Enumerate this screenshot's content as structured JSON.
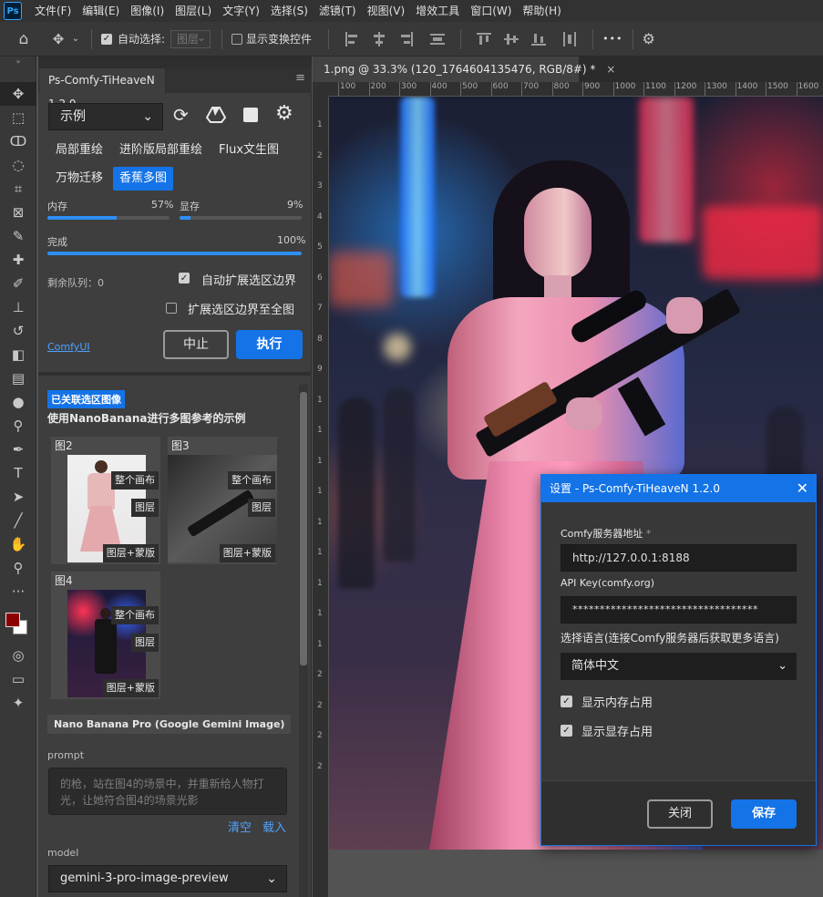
{
  "app": {
    "logo": "Ps"
  },
  "menu": [
    "文件(F)",
    "编辑(E)",
    "图像(I)",
    "图层(L)",
    "文字(Y)",
    "选择(S)",
    "滤镜(T)",
    "视图(V)",
    "增效工具",
    "窗口(W)",
    "帮助(H)"
  ],
  "options": {
    "auto_select_label": "自动选择:",
    "auto_select_checked": true,
    "layer_select_value": "图层",
    "show_transform_label": "显示变换控件",
    "more_glyph": "•••"
  },
  "panel": {
    "tab_title": "Ps-Comfy-TiHeaveN 1.2.0",
    "preset_select": "示例",
    "tags": [
      "局部重绘",
      "进阶版局部重绘",
      "Flux文生图",
      "万物迁移",
      "香蕉多图"
    ],
    "selected_tag": "香蕉多图",
    "memory": {
      "label": "内存",
      "value": "57%",
      "fraction": 0.57
    },
    "vram": {
      "label": "显存",
      "value": "9%",
      "fraction": 0.09
    },
    "progress": {
      "label": "完成",
      "value": "100%",
      "fraction": 1.0
    },
    "queue_label": "剩余队列：0",
    "auto_expand_label": "自动扩展选区边界",
    "auto_expand_checked": true,
    "expand_full_label": "扩展选区边界至全图",
    "expand_full_checked": false,
    "comfy_link": "ComfyUI",
    "stop_button": "中止",
    "run_button": "执行",
    "linked_badge": "已关联选区图像",
    "workflow_title": "使用NanoBanana进行多图参考的示例",
    "images": [
      {
        "title": "图2",
        "buttons": [
          "整个画布",
          "图层",
          "图层+蒙版"
        ]
      },
      {
        "title": "图3",
        "buttons": [
          "整个画布",
          "图层",
          "图层+蒙版"
        ]
      },
      {
        "title": "图4",
        "buttons": [
          "整个画布",
          "图层",
          "图层+蒙版"
        ]
      }
    ],
    "node_label": "Nano Banana Pro (Google Gemini Image)",
    "prompt_label": "prompt",
    "prompt_text": "的枪，站在图4的场景中，并重新给人物打光，让她符合图4的场景光影",
    "clear_link": "清空",
    "load_link": "载入",
    "model_label": "model",
    "model_value": "gemini-3-pro-image-preview"
  },
  "document": {
    "tab_title": "1.png @ 33.3% (120_1764604135476, RGB/8#) *",
    "close_glyph": "×",
    "ruler_top": [
      "100",
      "200",
      "300",
      "400",
      "500",
      "600",
      "700",
      "800",
      "900",
      "1000",
      "1100",
      "1200",
      "1300",
      "1400",
      "1500",
      "1600"
    ],
    "ruler_left": [
      "1",
      "2",
      "3",
      "4",
      "5",
      "6",
      "7",
      "8",
      "9",
      "1",
      "1",
      "1",
      "1",
      "1",
      "1",
      "1",
      "1",
      "1",
      "2",
      "2",
      "2",
      "2"
    ]
  },
  "dialog": {
    "title": "设置 - Ps-Comfy-TiHeaveN 1.2.0",
    "server_label": "Comfy服务器地址",
    "required_mark": "*",
    "server_value": "http://127.0.0.1:8188",
    "api_label": "API Key(comfy.org)",
    "api_value": "**********************************",
    "lang_label": "选择语言(连接Comfy服务器后获取更多语言)",
    "lang_value": "简体中文",
    "show_memory_label": "显示内存占用",
    "show_vram_label": "显示显存占用",
    "show_memory_checked": true,
    "show_vram_checked": true,
    "close_button": "关闭",
    "save_button": "保存"
  },
  "colors": {
    "accent": "#1473e6",
    "foreground_swatch": "#8b0000",
    "background_swatch": "#ffffff"
  }
}
